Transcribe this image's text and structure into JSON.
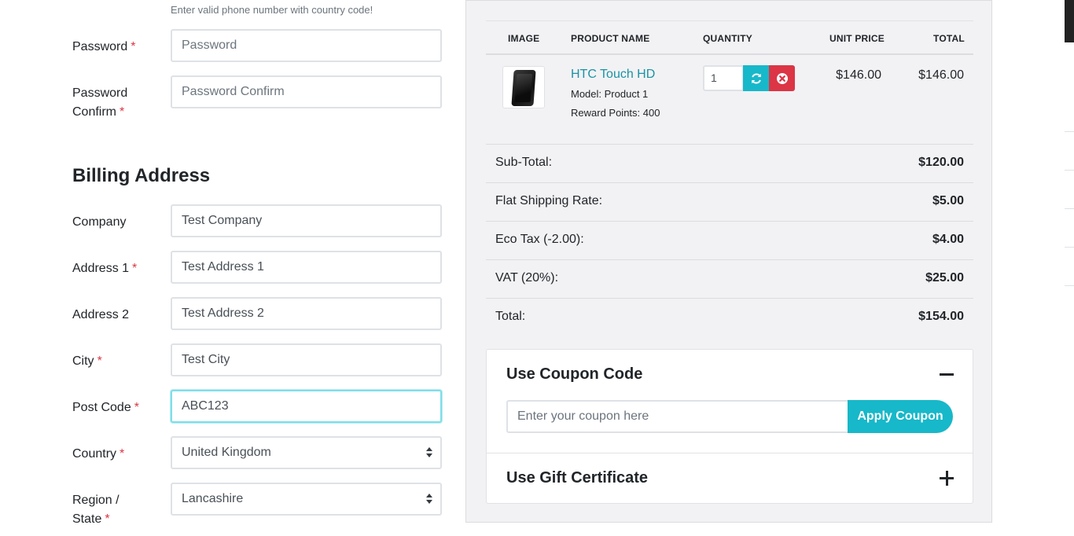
{
  "form": {
    "phone_hint": "Enter valid phone number with country code!",
    "password": {
      "label": "Password",
      "required": "*",
      "placeholder": "Password",
      "value": ""
    },
    "password_confirm": {
      "label_line1": "Password",
      "label_line2": "Confirm",
      "required": "*",
      "placeholder": "Password Confirm",
      "value": ""
    },
    "billing_title": "Billing Address",
    "company": {
      "label": "Company",
      "value": "Test Company"
    },
    "address1": {
      "label": "Address 1",
      "required": "*",
      "value": "Test Address 1"
    },
    "address2": {
      "label": "Address 2",
      "value": "Test Address 2"
    },
    "city": {
      "label": "City",
      "required": "*",
      "value": "Test City"
    },
    "postcode": {
      "label": "Post Code",
      "required": "*",
      "value": "ABC123"
    },
    "country": {
      "label": "Country",
      "required": "*",
      "value": "United Kingdom"
    },
    "region": {
      "label_line1": "Region /",
      "label_line2": "State",
      "required": "*",
      "value": "Lancashire"
    }
  },
  "cart": {
    "headers": {
      "image": "IMAGE",
      "product_name": "PRODUCT NAME",
      "quantity": "QUANTITY",
      "unit_price": "UNIT PRICE",
      "total": "TOTAL"
    },
    "item": {
      "name": "HTC Touch HD",
      "model": "Model: Product 1",
      "reward": "Reward Points: 400",
      "quantity": "1",
      "unit_price": "$146.00",
      "total": "$146.00",
      "image_icon": "phone-icon"
    },
    "totals": [
      {
        "label": "Sub-Total:",
        "value": "$120.00"
      },
      {
        "label": "Flat Shipping Rate:",
        "value": "$5.00"
      },
      {
        "label": "Eco Tax (-2.00):",
        "value": "$4.00"
      },
      {
        "label": "VAT (20%):",
        "value": "$25.00"
      },
      {
        "label": "Total:",
        "value": "$154.00"
      }
    ]
  },
  "coupon": {
    "title": "Use Coupon Code",
    "placeholder": "Enter your coupon here",
    "button": "Apply Coupon",
    "expanded": true
  },
  "gift": {
    "title": "Use Gift Certificate",
    "expanded": false
  },
  "colors": {
    "accent": "#17b8c9",
    "danger": "#dc3545",
    "link": "#1a93a6",
    "panel_bg": "#f2f2f4"
  }
}
